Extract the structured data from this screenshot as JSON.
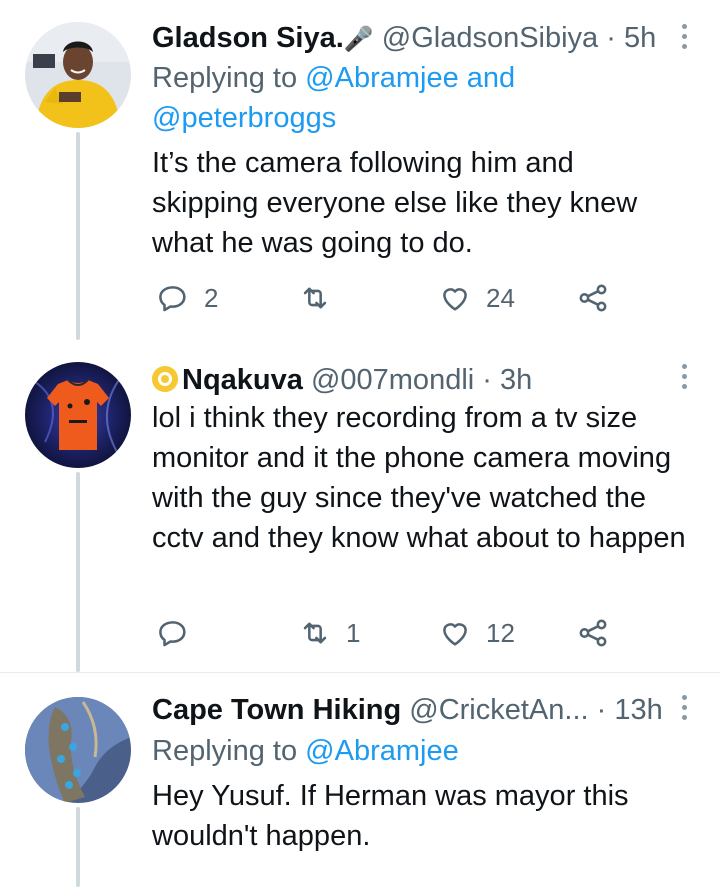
{
  "tweets": [
    {
      "name": "Gladson Siya.",
      "name_emoji": "🎤",
      "handle": "@GladsonSibiya",
      "time": "5h",
      "replying_prefix": "Replying to",
      "replying_line1": "@Abramjee and",
      "replying_line2": "@peterbroggs",
      "text": "It’s the camera following him and skipping everyone else like they knew what he was going to do.",
      "reply_count": "2",
      "retweet_count": "",
      "like_count": "24"
    },
    {
      "name": "Nqakuva",
      "handle": "@007mondli",
      "time": "3h",
      "text": "lol i think they recording from a tv size monitor and it the phone camera moving with the guy since they've watched the cctv and they know what about to happen",
      "reply_count": "",
      "retweet_count": "1",
      "like_count": "12"
    },
    {
      "name": "Cape Town Hiking",
      "handle": "@CricketAn...",
      "time": "13h",
      "replying_prefix": "Replying to",
      "replying_line1": "@Abramjee",
      "text": "Hey Yusuf. If Herman was mayor this wouldn't happen."
    }
  ],
  "separator": "·",
  "icons": {
    "reply": "reply-icon",
    "retweet": "retweet-icon",
    "like": "heart-icon",
    "share": "share-icon",
    "more": "more-vertical-icon"
  },
  "colors": {
    "link": "#1d9bf0",
    "muted": "#536471",
    "icon": "#536471",
    "line": "#cfd9de"
  }
}
